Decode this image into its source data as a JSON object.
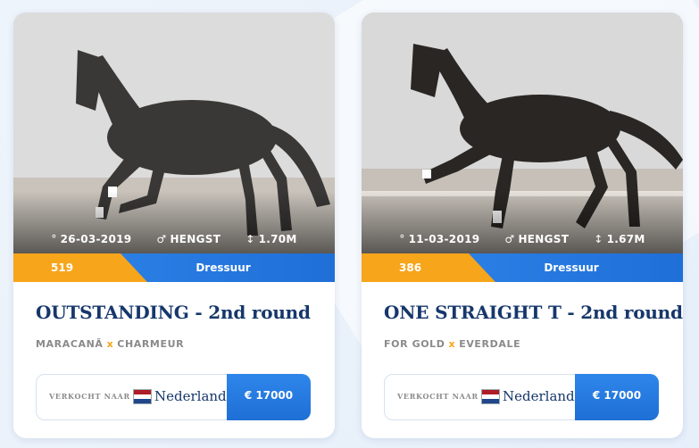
{
  "cards": [
    {
      "date": "26-03-2019",
      "gender": "HENGST",
      "height": "1.70M",
      "number": "519",
      "category": "Dressuur",
      "title": "OUTSTANDING - 2nd round",
      "sire": "MARACANÃ",
      "cross": "x",
      "dam_sire": "CHARMEUR",
      "sold_label": "VERKOCHT NAAR",
      "country": "Nederland",
      "price": "€ 17000"
    },
    {
      "date": "11-03-2019",
      "gender": "HENGST",
      "height": "1.67M",
      "number": "386",
      "category": "Dressuur",
      "title": "ONE STRAIGHT T - 2nd round",
      "sire": "FOR GOLD",
      "cross": "x",
      "dam_sire": "EVERDALE",
      "sold_label": "VERKOCHT NAAR",
      "country": "Nederland",
      "price": "€ 17000"
    }
  ],
  "icons": {
    "date": "circle-icon",
    "gender": "male-icon",
    "height": "height-arrow-icon",
    "flag": "netherlands-flag-icon"
  },
  "colors": {
    "accent_orange": "#f7a51b",
    "accent_blue": "#2f86ea",
    "title_navy": "#16376b",
    "flag_red": "#ae1c28",
    "flag_white": "#ffffff",
    "flag_blue": "#21468b"
  }
}
